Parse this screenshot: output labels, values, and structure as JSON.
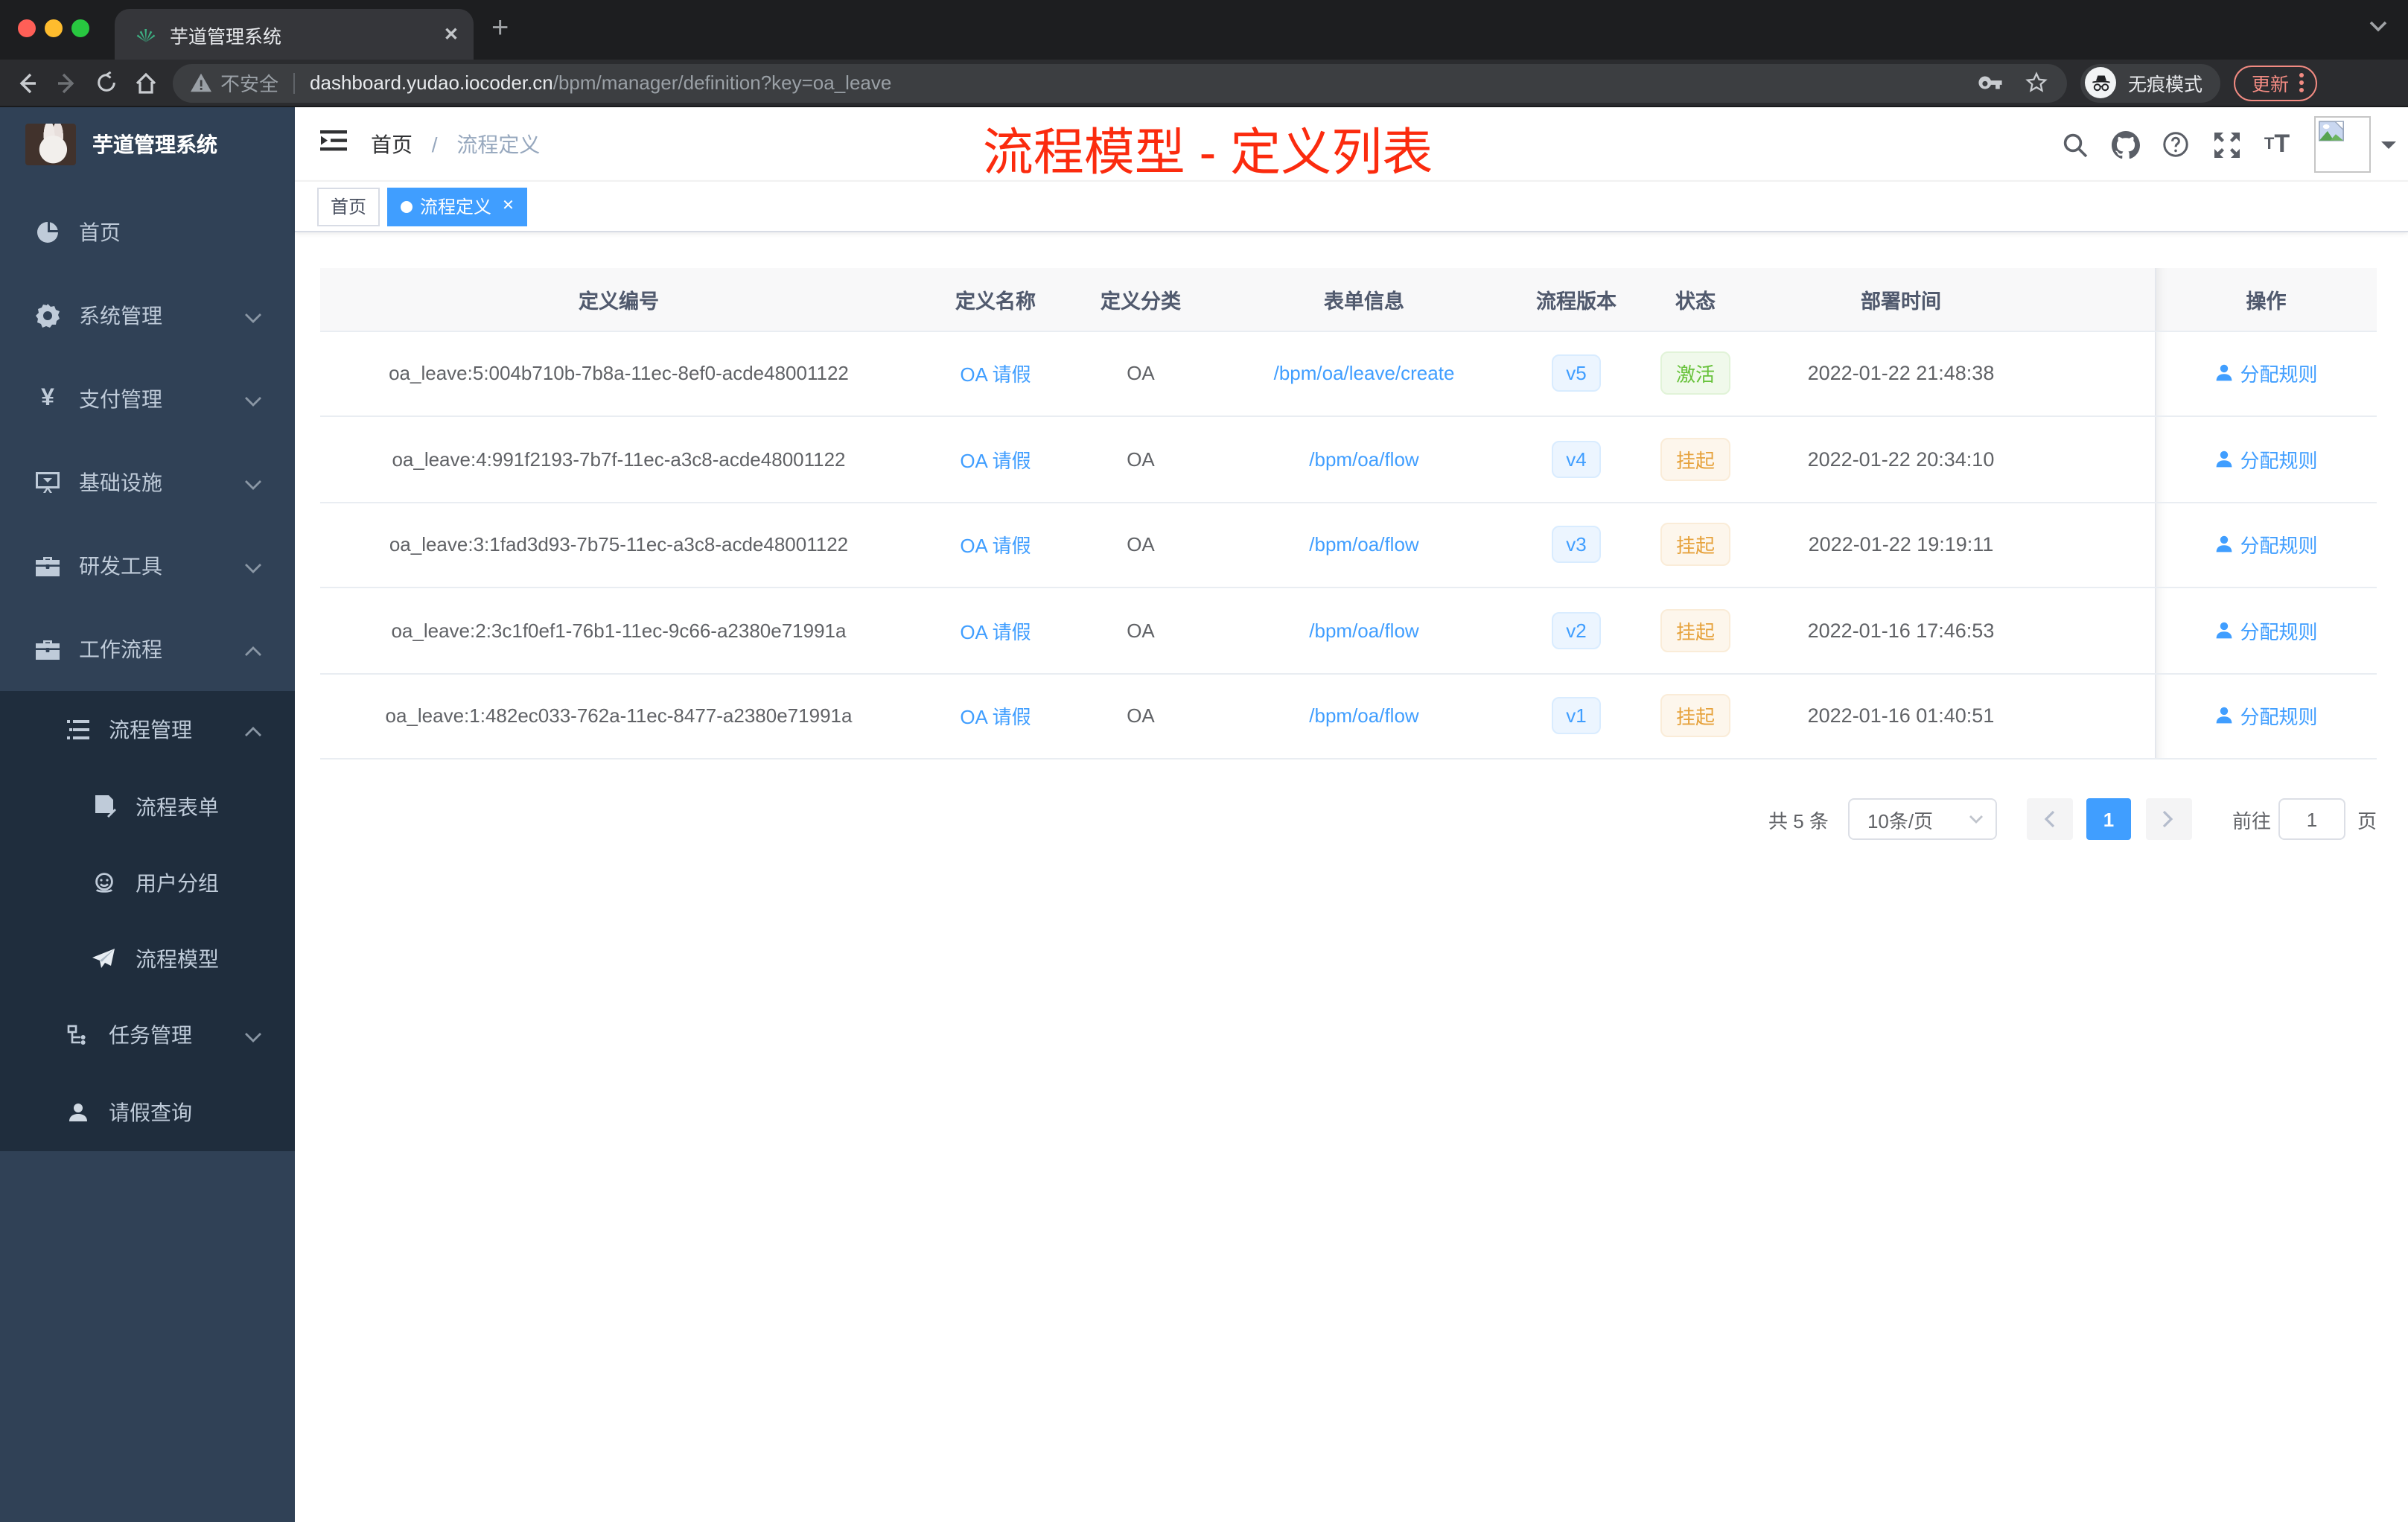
{
  "browser": {
    "tab": {
      "title": "芋道管理系统"
    },
    "address": {
      "security": "不安全",
      "host": "dashboard.yudao.iocoder.cn",
      "path": "/bpm/manager/definition?key=oa_leave"
    },
    "incognito_label": "无痕模式",
    "update_label": "更新"
  },
  "sidebar": {
    "logo_title": "芋道管理系统",
    "items": [
      {
        "label": "首页"
      },
      {
        "label": "系统管理"
      },
      {
        "label": "支付管理"
      },
      {
        "label": "基础设施"
      },
      {
        "label": "研发工具"
      },
      {
        "label": "工作流程"
      }
    ],
    "workflow": {
      "group_label": "流程管理",
      "children": [
        {
          "label": "流程表单"
        },
        {
          "label": "用户分组"
        },
        {
          "label": "流程模型"
        }
      ],
      "tasks_label": "任务管理",
      "leave_label": "请假查询"
    }
  },
  "navbar": {
    "breadcrumb": {
      "home": "首页",
      "current": "流程定义"
    },
    "annotation": "流程模型 - 定义列表"
  },
  "tags": {
    "home": "首页",
    "active": "流程定义"
  },
  "table": {
    "columns": [
      "定义编号",
      "定义名称",
      "定义分类",
      "表单信息",
      "流程版本",
      "状态",
      "部署时间",
      "操作"
    ],
    "action_label": "分配规则",
    "rows": [
      {
        "id": "oa_leave:5:004b710b-7b8a-11ec-8ef0-acde48001122",
        "name": "OA 请假",
        "category": "OA",
        "form": "/bpm/oa/leave/create",
        "version": "v5",
        "status": "激活",
        "time": "2022-01-22 21:48:38"
      },
      {
        "id": "oa_leave:4:991f2193-7b7f-11ec-a3c8-acde48001122",
        "name": "OA 请假",
        "category": "OA",
        "form": "/bpm/oa/flow",
        "version": "v4",
        "status": "挂起",
        "time": "2022-01-22 20:34:10"
      },
      {
        "id": "oa_leave:3:1fad3d93-7b75-11ec-a3c8-acde48001122",
        "name": "OA 请假",
        "category": "OA",
        "form": "/bpm/oa/flow",
        "version": "v3",
        "status": "挂起",
        "time": "2022-01-22 19:19:11"
      },
      {
        "id": "oa_leave:2:3c1f0ef1-76b1-11ec-9c66-a2380e71991a",
        "name": "OA 请假",
        "category": "OA",
        "form": "/bpm/oa/flow",
        "version": "v2",
        "status": "挂起",
        "time": "2022-01-16 17:46:53"
      },
      {
        "id": "oa_leave:1:482ec033-762a-11ec-8477-a2380e71991a",
        "name": "OA 请假",
        "category": "OA",
        "form": "/bpm/oa/flow",
        "version": "v1",
        "status": "挂起",
        "time": "2022-01-16 01:40:51"
      }
    ]
  },
  "pagination": {
    "total": "共 5 条",
    "page_size": "10条/页",
    "current_page": "1",
    "goto_label": "前往",
    "goto_value": "1",
    "page_label": "页"
  }
}
